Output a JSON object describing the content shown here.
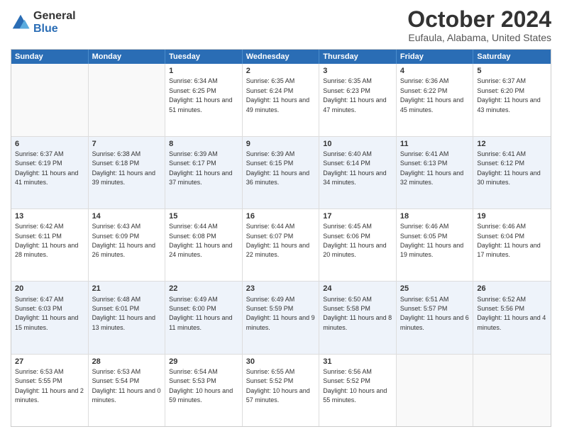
{
  "logo": {
    "general": "General",
    "blue": "Blue"
  },
  "title": "October 2024",
  "location": "Eufaula, Alabama, United States",
  "days": [
    "Sunday",
    "Monday",
    "Tuesday",
    "Wednesday",
    "Thursday",
    "Friday",
    "Saturday"
  ],
  "weeks": [
    [
      {
        "day": "",
        "sunrise": "",
        "sunset": "",
        "daylight": "",
        "empty": true,
        "alt": false
      },
      {
        "day": "",
        "sunrise": "",
        "sunset": "",
        "daylight": "",
        "empty": true,
        "alt": false
      },
      {
        "day": "1",
        "sunrise": "Sunrise: 6:34 AM",
        "sunset": "Sunset: 6:25 PM",
        "daylight": "Daylight: 11 hours and 51 minutes.",
        "empty": false,
        "alt": false
      },
      {
        "day": "2",
        "sunrise": "Sunrise: 6:35 AM",
        "sunset": "Sunset: 6:24 PM",
        "daylight": "Daylight: 11 hours and 49 minutes.",
        "empty": false,
        "alt": false
      },
      {
        "day": "3",
        "sunrise": "Sunrise: 6:35 AM",
        "sunset": "Sunset: 6:23 PM",
        "daylight": "Daylight: 11 hours and 47 minutes.",
        "empty": false,
        "alt": false
      },
      {
        "day": "4",
        "sunrise": "Sunrise: 6:36 AM",
        "sunset": "Sunset: 6:22 PM",
        "daylight": "Daylight: 11 hours and 45 minutes.",
        "empty": false,
        "alt": false
      },
      {
        "day": "5",
        "sunrise": "Sunrise: 6:37 AM",
        "sunset": "Sunset: 6:20 PM",
        "daylight": "Daylight: 11 hours and 43 minutes.",
        "empty": false,
        "alt": false
      }
    ],
    [
      {
        "day": "6",
        "sunrise": "Sunrise: 6:37 AM",
        "sunset": "Sunset: 6:19 PM",
        "daylight": "Daylight: 11 hours and 41 minutes.",
        "empty": false,
        "alt": true
      },
      {
        "day": "7",
        "sunrise": "Sunrise: 6:38 AM",
        "sunset": "Sunset: 6:18 PM",
        "daylight": "Daylight: 11 hours and 39 minutes.",
        "empty": false,
        "alt": true
      },
      {
        "day": "8",
        "sunrise": "Sunrise: 6:39 AM",
        "sunset": "Sunset: 6:17 PM",
        "daylight": "Daylight: 11 hours and 37 minutes.",
        "empty": false,
        "alt": true
      },
      {
        "day": "9",
        "sunrise": "Sunrise: 6:39 AM",
        "sunset": "Sunset: 6:15 PM",
        "daylight": "Daylight: 11 hours and 36 minutes.",
        "empty": false,
        "alt": true
      },
      {
        "day": "10",
        "sunrise": "Sunrise: 6:40 AM",
        "sunset": "Sunset: 6:14 PM",
        "daylight": "Daylight: 11 hours and 34 minutes.",
        "empty": false,
        "alt": true
      },
      {
        "day": "11",
        "sunrise": "Sunrise: 6:41 AM",
        "sunset": "Sunset: 6:13 PM",
        "daylight": "Daylight: 11 hours and 32 minutes.",
        "empty": false,
        "alt": true
      },
      {
        "day": "12",
        "sunrise": "Sunrise: 6:41 AM",
        "sunset": "Sunset: 6:12 PM",
        "daylight": "Daylight: 11 hours and 30 minutes.",
        "empty": false,
        "alt": true
      }
    ],
    [
      {
        "day": "13",
        "sunrise": "Sunrise: 6:42 AM",
        "sunset": "Sunset: 6:11 PM",
        "daylight": "Daylight: 11 hours and 28 minutes.",
        "empty": false,
        "alt": false
      },
      {
        "day": "14",
        "sunrise": "Sunrise: 6:43 AM",
        "sunset": "Sunset: 6:09 PM",
        "daylight": "Daylight: 11 hours and 26 minutes.",
        "empty": false,
        "alt": false
      },
      {
        "day": "15",
        "sunrise": "Sunrise: 6:44 AM",
        "sunset": "Sunset: 6:08 PM",
        "daylight": "Daylight: 11 hours and 24 minutes.",
        "empty": false,
        "alt": false
      },
      {
        "day": "16",
        "sunrise": "Sunrise: 6:44 AM",
        "sunset": "Sunset: 6:07 PM",
        "daylight": "Daylight: 11 hours and 22 minutes.",
        "empty": false,
        "alt": false
      },
      {
        "day": "17",
        "sunrise": "Sunrise: 6:45 AM",
        "sunset": "Sunset: 6:06 PM",
        "daylight": "Daylight: 11 hours and 20 minutes.",
        "empty": false,
        "alt": false
      },
      {
        "day": "18",
        "sunrise": "Sunrise: 6:46 AM",
        "sunset": "Sunset: 6:05 PM",
        "daylight": "Daylight: 11 hours and 19 minutes.",
        "empty": false,
        "alt": false
      },
      {
        "day": "19",
        "sunrise": "Sunrise: 6:46 AM",
        "sunset": "Sunset: 6:04 PM",
        "daylight": "Daylight: 11 hours and 17 minutes.",
        "empty": false,
        "alt": false
      }
    ],
    [
      {
        "day": "20",
        "sunrise": "Sunrise: 6:47 AM",
        "sunset": "Sunset: 6:03 PM",
        "daylight": "Daylight: 11 hours and 15 minutes.",
        "empty": false,
        "alt": true
      },
      {
        "day": "21",
        "sunrise": "Sunrise: 6:48 AM",
        "sunset": "Sunset: 6:01 PM",
        "daylight": "Daylight: 11 hours and 13 minutes.",
        "empty": false,
        "alt": true
      },
      {
        "day": "22",
        "sunrise": "Sunrise: 6:49 AM",
        "sunset": "Sunset: 6:00 PM",
        "daylight": "Daylight: 11 hours and 11 minutes.",
        "empty": false,
        "alt": true
      },
      {
        "day": "23",
        "sunrise": "Sunrise: 6:49 AM",
        "sunset": "Sunset: 5:59 PM",
        "daylight": "Daylight: 11 hours and 9 minutes.",
        "empty": false,
        "alt": true
      },
      {
        "day": "24",
        "sunrise": "Sunrise: 6:50 AM",
        "sunset": "Sunset: 5:58 PM",
        "daylight": "Daylight: 11 hours and 8 minutes.",
        "empty": false,
        "alt": true
      },
      {
        "day": "25",
        "sunrise": "Sunrise: 6:51 AM",
        "sunset": "Sunset: 5:57 PM",
        "daylight": "Daylight: 11 hours and 6 minutes.",
        "empty": false,
        "alt": true
      },
      {
        "day": "26",
        "sunrise": "Sunrise: 6:52 AM",
        "sunset": "Sunset: 5:56 PM",
        "daylight": "Daylight: 11 hours and 4 minutes.",
        "empty": false,
        "alt": true
      }
    ],
    [
      {
        "day": "27",
        "sunrise": "Sunrise: 6:53 AM",
        "sunset": "Sunset: 5:55 PM",
        "daylight": "Daylight: 11 hours and 2 minutes.",
        "empty": false,
        "alt": false
      },
      {
        "day": "28",
        "sunrise": "Sunrise: 6:53 AM",
        "sunset": "Sunset: 5:54 PM",
        "daylight": "Daylight: 11 hours and 0 minutes.",
        "empty": false,
        "alt": false
      },
      {
        "day": "29",
        "sunrise": "Sunrise: 6:54 AM",
        "sunset": "Sunset: 5:53 PM",
        "daylight": "Daylight: 10 hours and 59 minutes.",
        "empty": false,
        "alt": false
      },
      {
        "day": "30",
        "sunrise": "Sunrise: 6:55 AM",
        "sunset": "Sunset: 5:52 PM",
        "daylight": "Daylight: 10 hours and 57 minutes.",
        "empty": false,
        "alt": false
      },
      {
        "day": "31",
        "sunrise": "Sunrise: 6:56 AM",
        "sunset": "Sunset: 5:52 PM",
        "daylight": "Daylight: 10 hours and 55 minutes.",
        "empty": false,
        "alt": false
      },
      {
        "day": "",
        "sunrise": "",
        "sunset": "",
        "daylight": "",
        "empty": true,
        "alt": false
      },
      {
        "day": "",
        "sunrise": "",
        "sunset": "",
        "daylight": "",
        "empty": true,
        "alt": false
      }
    ]
  ]
}
